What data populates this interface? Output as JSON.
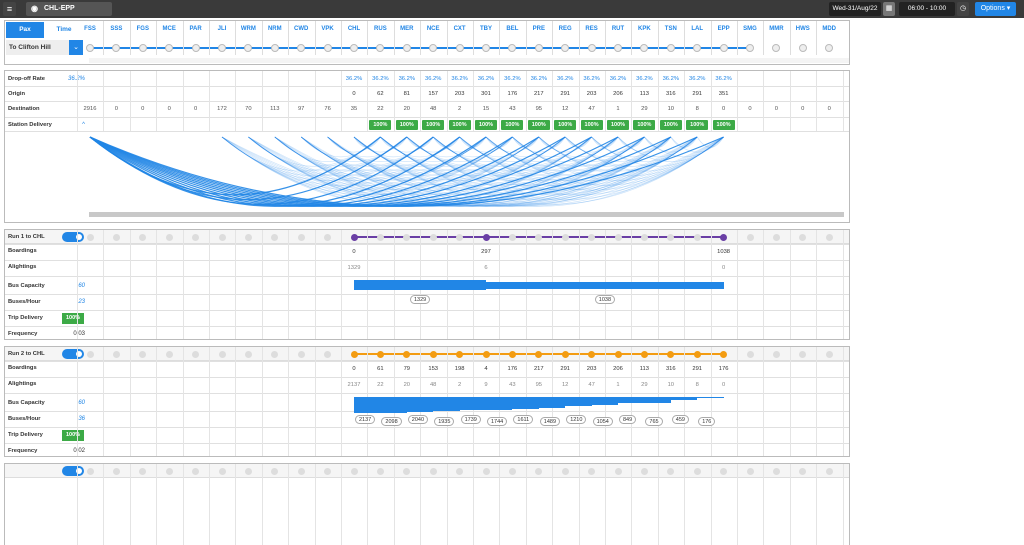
{
  "topbar": {
    "route": "CHL-EPP",
    "date": "Wed-31/Aug/22",
    "time_range": "06:00 - 10:00",
    "options_label": "Options"
  },
  "header": {
    "pax_tab": "Pax",
    "time_tab": "Time",
    "destination": "To Clifton Hill"
  },
  "stations": [
    "FSS",
    "SSS",
    "FGS",
    "MCE",
    "PAR",
    "JLI",
    "WRM",
    "NRM",
    "CWD",
    "VPK",
    "CHL",
    "RUS",
    "MER",
    "NCE",
    "CXT",
    "TBY",
    "BEL",
    "PRE",
    "REG",
    "RES",
    "RUT",
    "KPK",
    "TSN",
    "LAL",
    "EPP",
    "SMG",
    "MMR",
    "HWS",
    "MDD"
  ],
  "delivery": {
    "dropoff_label": "Drop-off Rate",
    "dropoff_value": "36.2%",
    "origin_label": "Origin",
    "destination_label": "Destination",
    "station_delivery_label": "Station Delivery",
    "dropoff": [
      "",
      "",
      "",
      "",
      "",
      "",
      "",
      "",
      "",
      "",
      "36.2%",
      "36.2%",
      "36.2%",
      "36.2%",
      "36.2%",
      "36.2%",
      "36.2%",
      "36.2%",
      "36.2%",
      "36.2%",
      "36.2%",
      "36.2%",
      "36.2%",
      "36.2%",
      "36.2%",
      "",
      "",
      "",
      ""
    ],
    "origin": [
      "",
      "",
      "",
      "",
      "",
      "",
      "",
      "",
      "",
      "",
      "0",
      "62",
      "81",
      "157",
      "203",
      "301",
      "176",
      "217",
      "291",
      "203",
      "206",
      "113",
      "316",
      "291",
      "351",
      "",
      "",
      "",
      ""
    ],
    "destination": [
      "2916",
      "0",
      "0",
      "0",
      "0",
      "172",
      "70",
      "113",
      "97",
      "76",
      "35",
      "22",
      "20",
      "48",
      "2",
      "15",
      "43",
      "95",
      "12",
      "47",
      "1",
      "29",
      "10",
      "8",
      "0",
      "0",
      "0",
      "0",
      "0"
    ],
    "pct": "100%"
  },
  "runs": [
    {
      "title": "Run 1 to CHL",
      "boardings_label": "Boardings",
      "alightings_label": "Alightings",
      "bus_capacity_label": "Bus Capacity",
      "bus_capacity": "60",
      "buses_hour_label": "Buses/Hour",
      "buses_hour": "23",
      "trip_delivery_label": "Trip Delivery",
      "trip_delivery": "100%",
      "frequency_label": "Frequency",
      "frequency": "0:03",
      "boardings": [
        "",
        "",
        "",
        "",
        "",
        "",
        "",
        "",
        "",
        "",
        "0",
        "",
        "",
        "",
        "",
        "297",
        "",
        "",
        "",
        "",
        "",
        "",
        "",
        "",
        "1038",
        "",
        "",
        "",
        ""
      ],
      "alightings": [
        "",
        "",
        "",
        "",
        "",
        "",
        "",
        "",
        "",
        "",
        "1329",
        "",
        "",
        "",
        "",
        "6",
        "",
        "",
        "",
        "",
        "",
        "",
        "",
        "",
        "0",
        "",
        "",
        "",
        ""
      ],
      "loads": [
        "1329",
        "1038"
      ]
    },
    {
      "title": "Run 2 to CHL",
      "boardings_label": "Boardings",
      "alightings_label": "Alightings",
      "bus_capacity_label": "Bus Capacity",
      "bus_capacity": "60",
      "buses_hour_label": "Buses/Hour",
      "buses_hour": "36",
      "trip_delivery_label": "Trip Delivery",
      "trip_delivery": "100%",
      "frequency_label": "Frequency",
      "frequency": "0:02",
      "boardings": [
        "",
        "",
        "",
        "",
        "",
        "",
        "",
        "",
        "",
        "",
        "0",
        "61",
        "79",
        "153",
        "198",
        "4",
        "176",
        "217",
        "291",
        "203",
        "206",
        "113",
        "316",
        "291",
        "176",
        "",
        "",
        "",
        ""
      ],
      "alightings": [
        "",
        "",
        "",
        "",
        "",
        "",
        "",
        "",
        "",
        "",
        "2137",
        "22",
        "20",
        "48",
        "2",
        "9",
        "43",
        "95",
        "12",
        "47",
        "1",
        "29",
        "10",
        "8",
        "0",
        "",
        "",
        "",
        ""
      ],
      "loads": [
        "2137",
        "2098",
        "2040",
        "1935",
        "1739",
        "1744",
        "1611",
        "1489",
        "1210",
        "1054",
        "849",
        "765",
        "459",
        "176"
      ]
    }
  ],
  "colors": {
    "accent": "#2186e6",
    "run1": "#6a3fa5",
    "run2": "#f39c12",
    "green": "#3caa46"
  }
}
